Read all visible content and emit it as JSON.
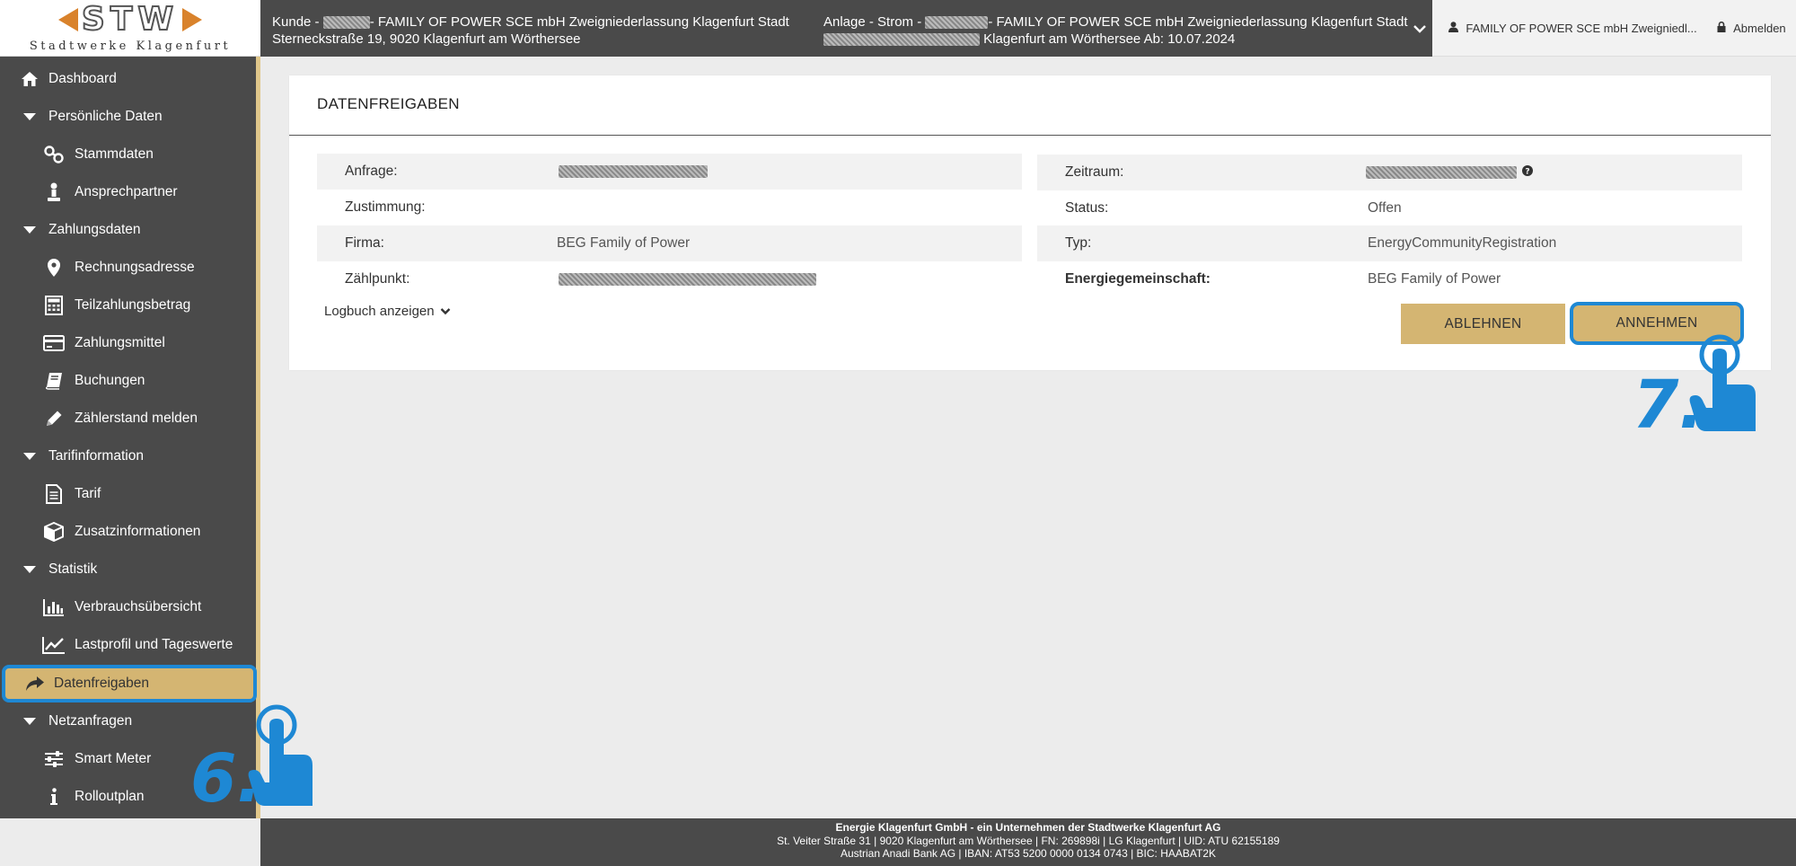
{
  "header": {
    "logo_text": "STW",
    "logo_subtitle": "Stadtwerke Klagenfurt",
    "kunde_prefix": "Kunde -",
    "kunde_name": "- FAMILY OF POWER SCE mbH Zweigniederlassung Klagenfurt Stadt",
    "kunde_address": "Sterneckstraße 19, 9020 Klagenfurt am Wörthersee",
    "anlage_prefix": "Anlage - Strom -",
    "anlage_name": "- FAMILY OF POWER SCE mbH Zweigniederlassung Klagenfurt Stadt",
    "anlage_address": "Klagenfurt am Wörthersee Ab: 10.07.2024",
    "user_label": "FAMILY OF POWER SCE mbH Zweigniedl...",
    "logout_label": "Abmelden"
  },
  "sidebar": {
    "items": [
      {
        "label": "Dashboard",
        "icon": "home-icon",
        "level": "top"
      },
      {
        "label": "Persönliche Daten",
        "icon": "caret-down-icon",
        "level": "top"
      },
      {
        "label": "Stammdaten",
        "icon": "link-icon",
        "level": "sub"
      },
      {
        "label": "Ansprechpartner",
        "icon": "person-icon",
        "level": "sub"
      },
      {
        "label": "Zahlungsdaten",
        "icon": "caret-down-icon",
        "level": "top"
      },
      {
        "label": "Rechnungsadresse",
        "icon": "map-marker-icon",
        "level": "sub"
      },
      {
        "label": "Teilzahlungsbetrag",
        "icon": "calculator-icon",
        "level": "sub"
      },
      {
        "label": "Zahlungsmittel",
        "icon": "credit-card-icon",
        "level": "sub"
      },
      {
        "label": "Buchungen",
        "icon": "book-icon",
        "level": "sub"
      },
      {
        "label": "Zählerstand melden",
        "icon": "pencil-icon",
        "level": "sub"
      },
      {
        "label": "Tarifinformation",
        "icon": "caret-down-icon",
        "level": "top"
      },
      {
        "label": "Tarif",
        "icon": "document-icon",
        "level": "sub"
      },
      {
        "label": "Zusatzinformationen",
        "icon": "cube-icon",
        "level": "sub"
      },
      {
        "label": "Statistik",
        "icon": "caret-down-icon",
        "level": "top"
      },
      {
        "label": "Verbrauchsübersicht",
        "icon": "bar-chart-icon",
        "level": "sub"
      },
      {
        "label": "Lastprofil und Tageswerte",
        "icon": "line-chart-icon",
        "level": "sub"
      },
      {
        "label": "Datenfreigaben",
        "icon": "share-icon",
        "level": "top",
        "active": true
      },
      {
        "label": "Netzanfragen",
        "icon": "caret-down-icon",
        "level": "top"
      },
      {
        "label": "Smart Meter",
        "icon": "sliders-icon",
        "level": "sub"
      },
      {
        "label": "Rolloutplan",
        "icon": "info-icon",
        "level": "sub"
      }
    ]
  },
  "card": {
    "title": "DATENFREIGABEN",
    "left_rows": [
      {
        "label": "Anfrage:",
        "value": ""
      },
      {
        "label": "Zustimmung:",
        "value": ""
      },
      {
        "label": "Firma:",
        "value": "BEG Family of Power"
      },
      {
        "label": "Zählpunkt:",
        "value": ""
      }
    ],
    "right_rows": [
      {
        "label": "Zeitraum:",
        "value": ""
      },
      {
        "label": "Status:",
        "value": "Offen"
      },
      {
        "label": "Typ:",
        "value": "EnergyCommunityRegistration"
      },
      {
        "label": "Energiegemeinschaft:",
        "value": "BEG Family of Power"
      }
    ],
    "logbuch_label": "Logbuch anzeigen",
    "reject_label": "ABLEHNEN",
    "accept_label": "ANNEHMEN"
  },
  "steps": {
    "step6": "6.",
    "step7": "7."
  },
  "footer": {
    "line1_bold": "Energie Klagenfurt GmbH",
    "line1_rest": " - ein Unternehmen der Stadtwerke Klagenfurt AG",
    "line2": "St. Veiter Straße 31 | 9020 Klagenfurt am Wörthersee | FN: 269898i | LG Klagenfurt | UID: ATU 62155189",
    "line3": "Austrian Anadi Bank AG | IBAN: AT53 5200 0000 0134 0743 | BIC: HAABAT2K"
  },
  "colors": {
    "accent_gold": "#d4b572",
    "highlight_blue": "#1e88d4",
    "sidebar_bg": "#4a4a4a"
  }
}
